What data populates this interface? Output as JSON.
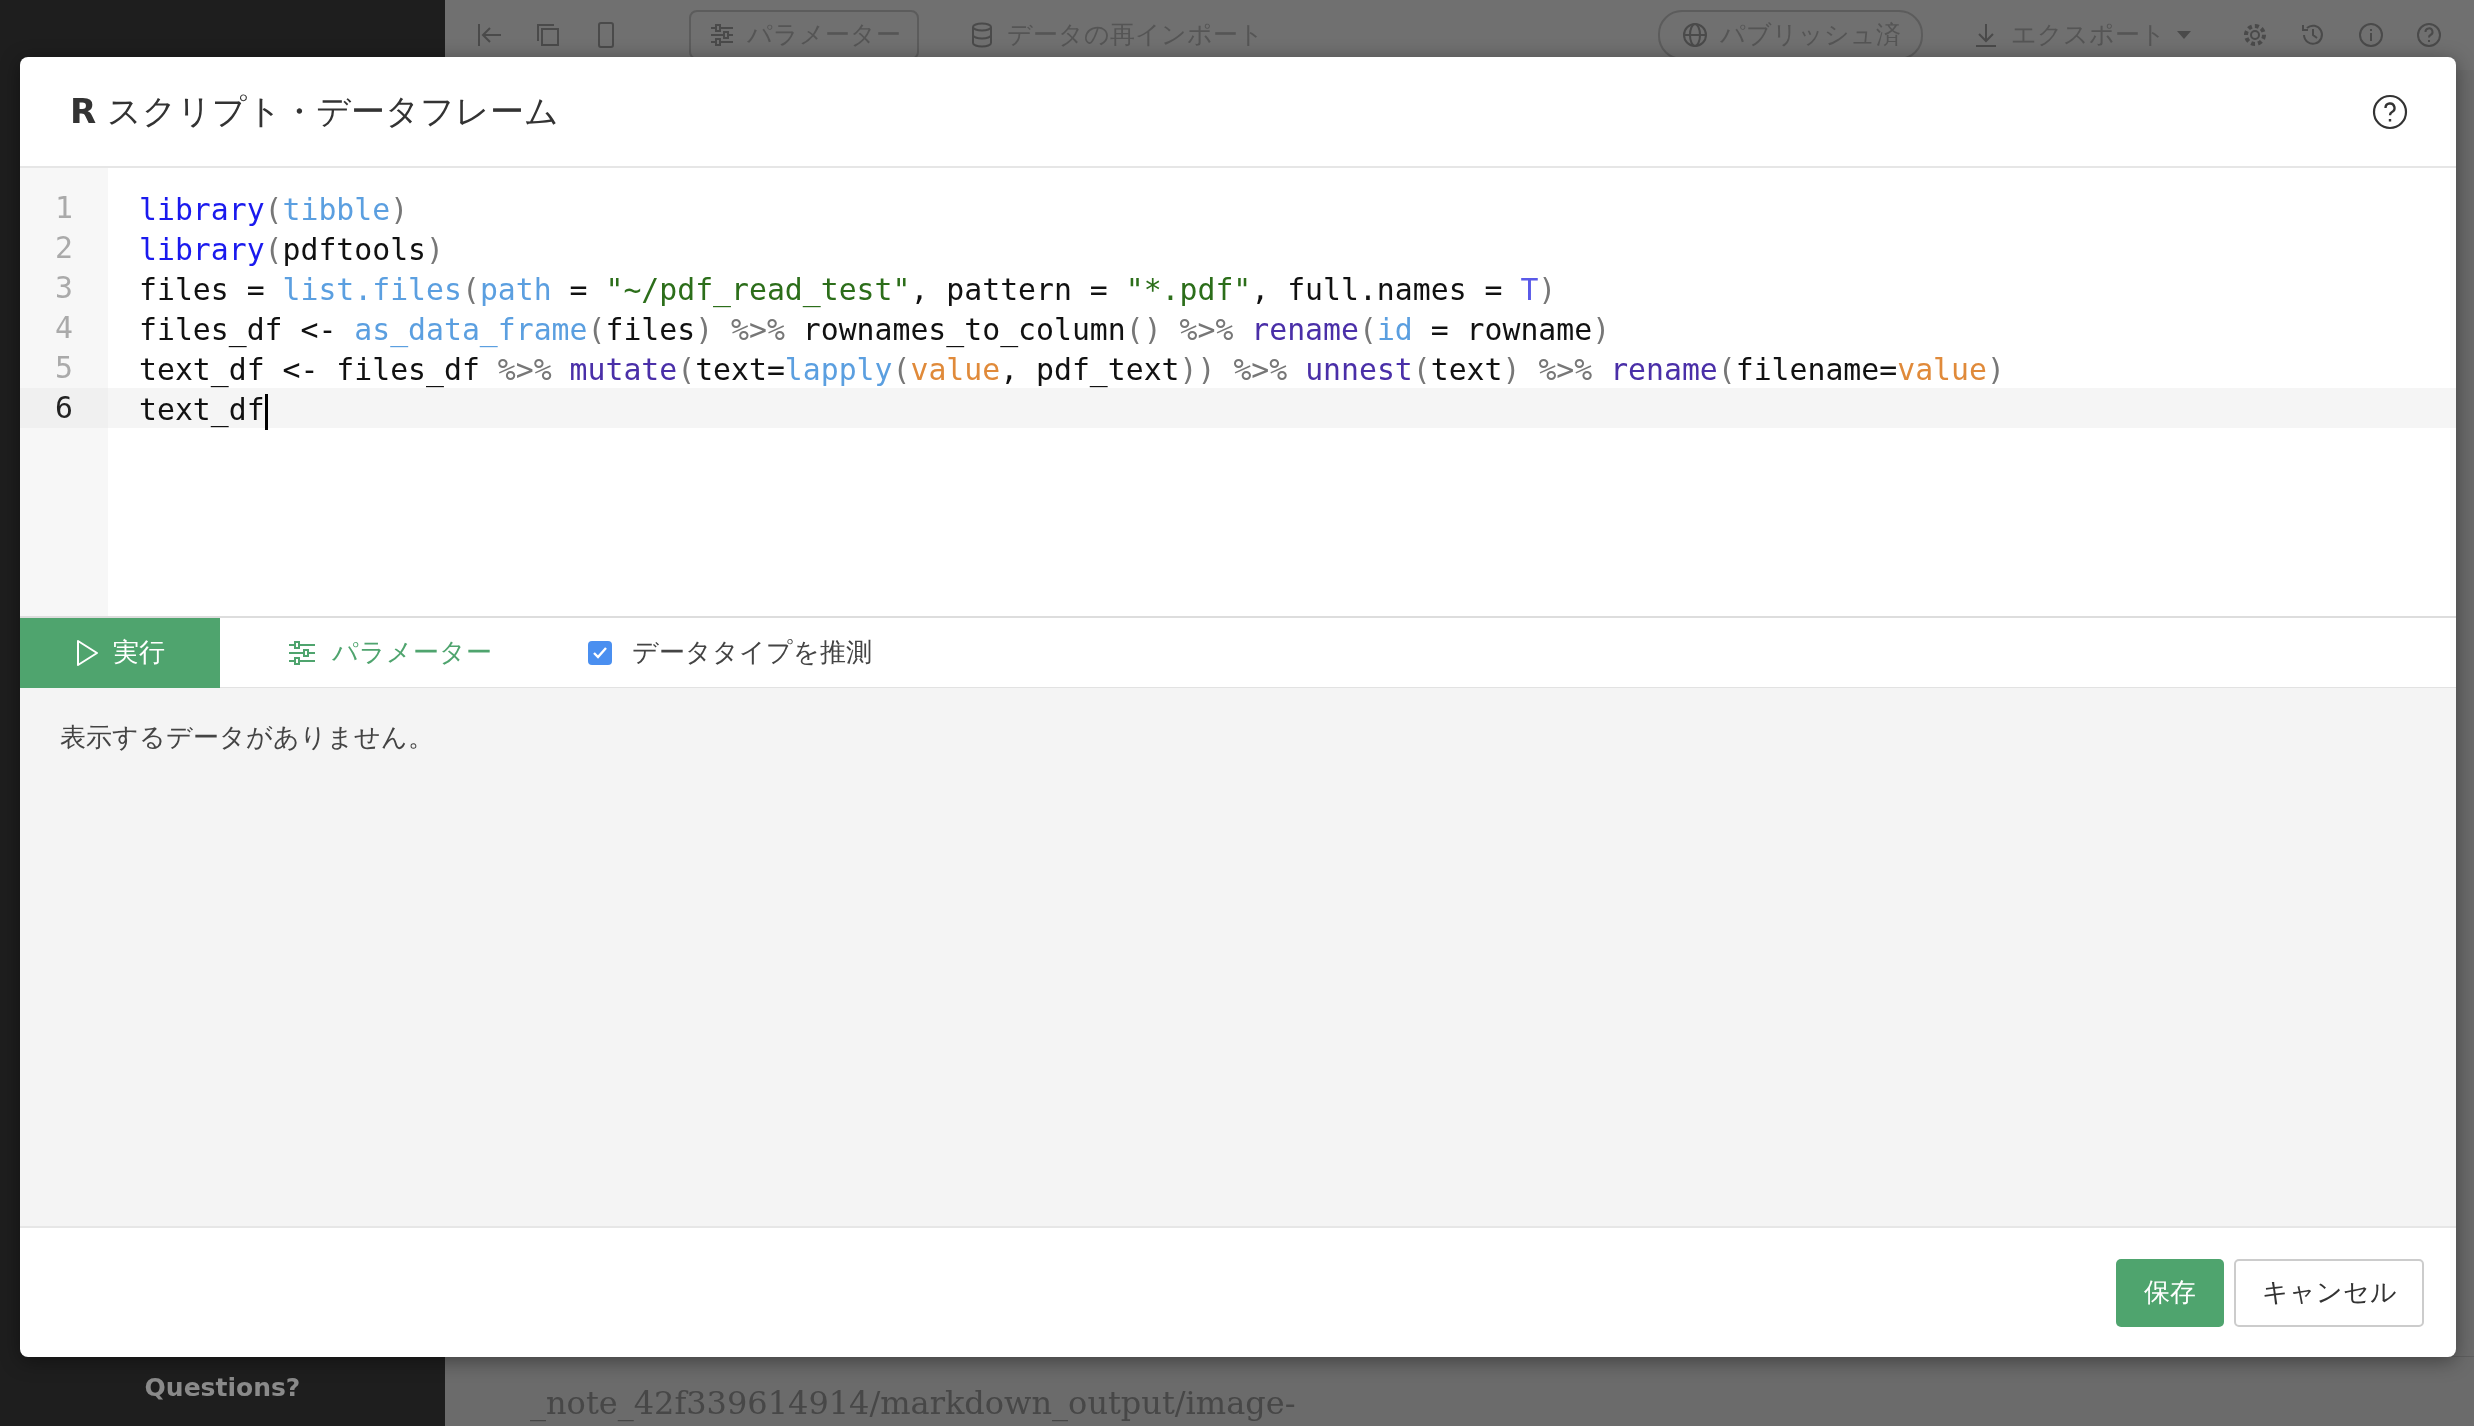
{
  "background": {
    "sidebar": {
      "footer": "Questions?"
    },
    "toolbar": {
      "parameters": "パラメーター",
      "reimport": "データの再インポート",
      "published": "パブリッシュ済",
      "export": "エクスポート"
    },
    "content_text": "_note_42f339614914/markdown_output/image-"
  },
  "dialog": {
    "title": "**R** スクリプト・データフレーム",
    "code_lines": [
      {
        "number": "1",
        "current": false,
        "tokens": [
          {
            "kind": "keyword",
            "text": "library"
          },
          {
            "kind": "punct",
            "text": "("
          },
          {
            "kind": "func",
            "text": "tibble"
          },
          {
            "kind": "punct",
            "text": ")"
          }
        ]
      },
      {
        "number": "2",
        "current": false,
        "tokens": [
          {
            "kind": "keyword",
            "text": "library"
          },
          {
            "kind": "punct",
            "text": "("
          },
          {
            "kind": "plain",
            "text": "pdftools"
          },
          {
            "kind": "punct",
            "text": ")"
          }
        ]
      },
      {
        "number": "3",
        "current": false,
        "tokens": [
          {
            "kind": "plain",
            "text": "files = "
          },
          {
            "kind": "func",
            "text": "list.files"
          },
          {
            "kind": "punct",
            "text": "("
          },
          {
            "kind": "func",
            "text": "path"
          },
          {
            "kind": "plain",
            "text": " = "
          },
          {
            "kind": "string",
            "text": "\"~/pdf_read_test\""
          },
          {
            "kind": "plain",
            "text": ", pattern = "
          },
          {
            "kind": "string",
            "text": "\"*.pdf\""
          },
          {
            "kind": "plain",
            "text": ", full.names = "
          },
          {
            "kind": "const",
            "text": "T"
          },
          {
            "kind": "punct",
            "text": ")"
          }
        ]
      },
      {
        "number": "4",
        "current": false,
        "tokens": [
          {
            "kind": "plain",
            "text": "files_df <- "
          },
          {
            "kind": "func",
            "text": "as_data_frame"
          },
          {
            "kind": "punct",
            "text": "("
          },
          {
            "kind": "plain",
            "text": "files"
          },
          {
            "kind": "punct",
            "text": ") %>%"
          },
          {
            "kind": "plain",
            "text": " rownames_to_column"
          },
          {
            "kind": "punct",
            "text": "() %>% "
          },
          {
            "kind": "verb",
            "text": "rename"
          },
          {
            "kind": "punct",
            "text": "("
          },
          {
            "kind": "func",
            "text": "id"
          },
          {
            "kind": "plain",
            "text": " = rowname"
          },
          {
            "kind": "punct",
            "text": ")"
          }
        ]
      },
      {
        "number": "5",
        "current": false,
        "tokens": [
          {
            "kind": "plain",
            "text": "text_df <- files_df "
          },
          {
            "kind": "punct",
            "text": "%>% "
          },
          {
            "kind": "verb",
            "text": "mutate"
          },
          {
            "kind": "punct",
            "text": "("
          },
          {
            "kind": "plain",
            "text": "text="
          },
          {
            "kind": "func",
            "text": "lapply"
          },
          {
            "kind": "punct",
            "text": "("
          },
          {
            "kind": "value",
            "text": "value"
          },
          {
            "kind": "plain",
            "text": ", pdf_text"
          },
          {
            "kind": "punct",
            "text": ")) %>% "
          },
          {
            "kind": "verb",
            "text": "unnest"
          },
          {
            "kind": "punct",
            "text": "("
          },
          {
            "kind": "plain",
            "text": "text"
          },
          {
            "kind": "punct",
            "text": ") %>% "
          },
          {
            "kind": "verb",
            "text": "rename"
          },
          {
            "kind": "punct",
            "text": "("
          },
          {
            "kind": "plain",
            "text": "filename="
          },
          {
            "kind": "value",
            "text": "value"
          },
          {
            "kind": "punct",
            "text": ")"
          }
        ]
      },
      {
        "number": "6",
        "current": true,
        "tokens": [
          {
            "kind": "plain",
            "text": "text_df"
          }
        ]
      }
    ],
    "run_button": "実行",
    "parameters_button": "パラメーター",
    "infer_types": {
      "label": "データタイプを推測",
      "checked": true
    },
    "result_message": "表示するデータがありません。",
    "save_button": "保存",
    "cancel_button": "キャンセル"
  }
}
